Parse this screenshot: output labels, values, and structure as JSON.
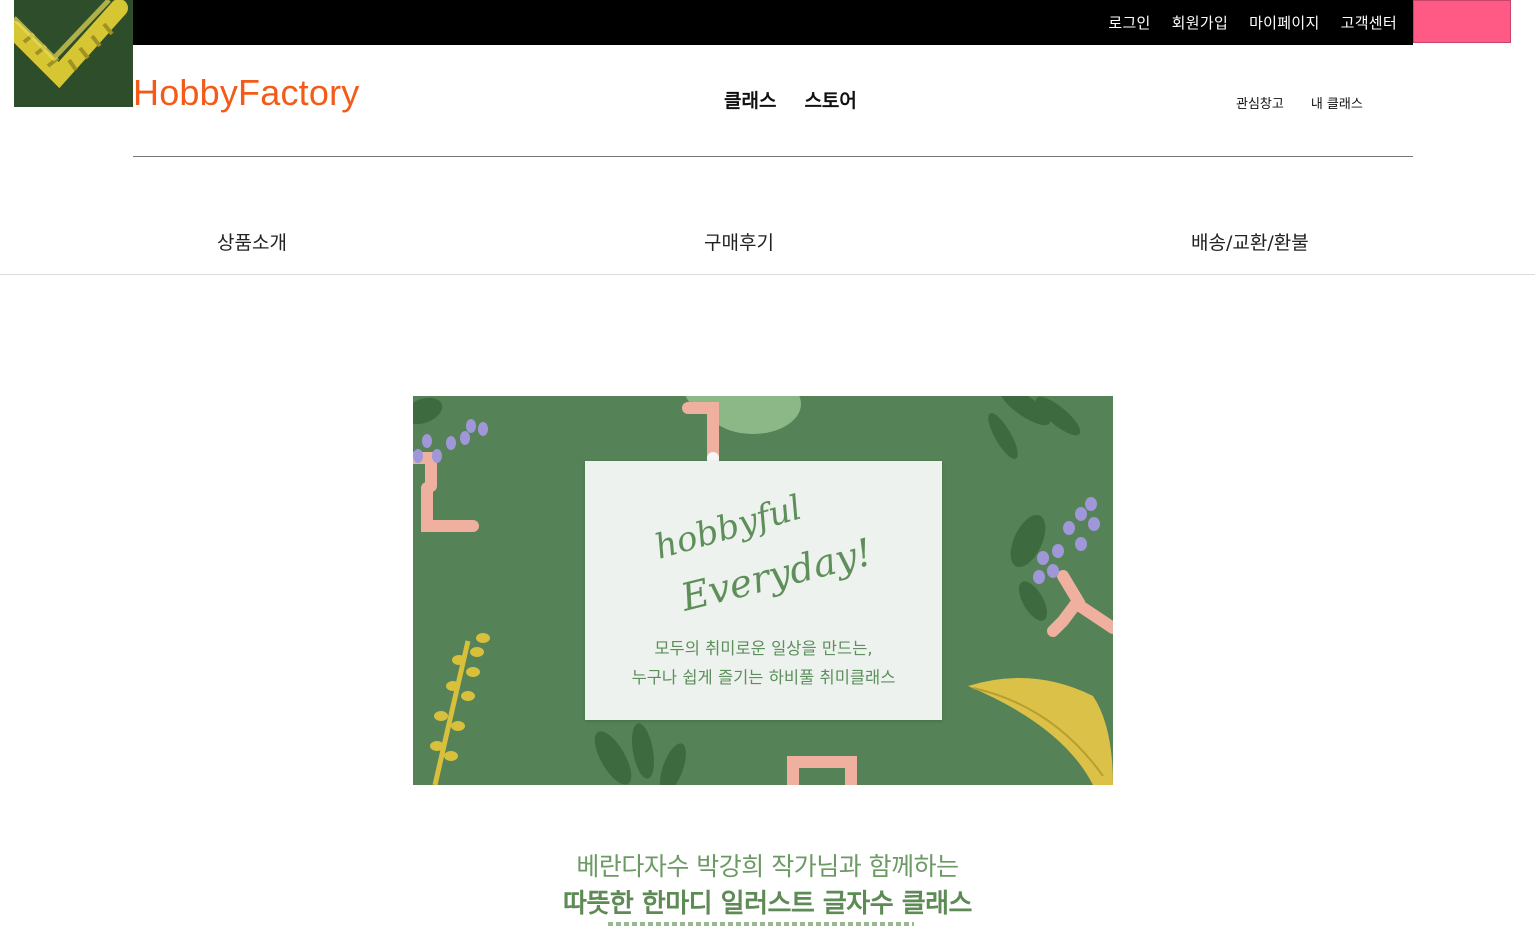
{
  "topbar": {
    "links": [
      "로그인",
      "회원가입",
      "마이페이지",
      "고객센터"
    ],
    "background": "#000000",
    "accent_box_color": "#ff5a85"
  },
  "header": {
    "logo": "HobbyFactory",
    "logo_color": "#f45a18",
    "main_nav": [
      "클래스",
      "스토어"
    ],
    "user_nav": [
      "관심창고",
      "내 클래스"
    ]
  },
  "tabs": [
    "상품소개",
    "구매후기",
    "배송/교환/환불"
  ],
  "banner": {
    "script_line1": "hobbyful",
    "script_line2": "Everyday!",
    "caption_line1": "모두의 취미로운 일상을 만드는,",
    "caption_line2": "누구나 쉽게 즐기는 하비풀 취미클래스",
    "background": "#558256"
  },
  "description": {
    "line1": "베란다자수 박강희 작가님과 함께하는",
    "line2": "따뜻한 한마디 일러스트 글자수 클래스"
  },
  "icons": {
    "thumbnail": "embroidery-thumbnail-icon"
  }
}
